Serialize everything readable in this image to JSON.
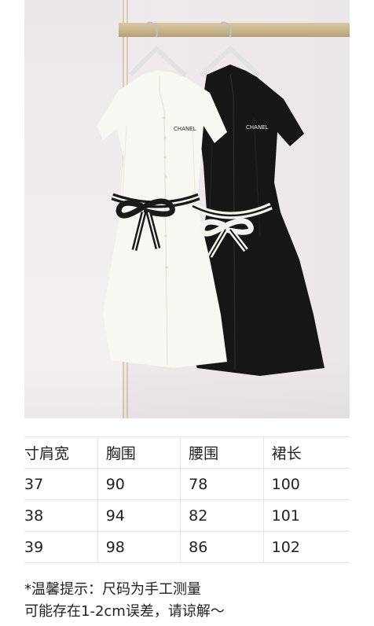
{
  "product_photo": {
    "brand_label_white": "CHANEL",
    "brand_label_black": "CHANEL",
    "colors": {
      "wall": "#efe9ec",
      "rail": "#c8b58d",
      "white_dress": "#f8f7f2",
      "black_dress": "#161616",
      "belt_black": "#1a1a1a",
      "belt_white": "#f5f5f0"
    }
  },
  "size_table": {
    "headers": [
      "寸肩宽",
      "胸围",
      "腰围",
      "裙长"
    ],
    "rows": [
      [
        "37",
        "90",
        "78",
        "100"
      ],
      [
        "38",
        "94",
        "82",
        "101"
      ],
      [
        "39",
        "98",
        "86",
        "102"
      ]
    ]
  },
  "note": {
    "line1": "*温馨提示：尺码为手工测量",
    "line2": "可能存在1-2cm误差，请谅解～"
  }
}
